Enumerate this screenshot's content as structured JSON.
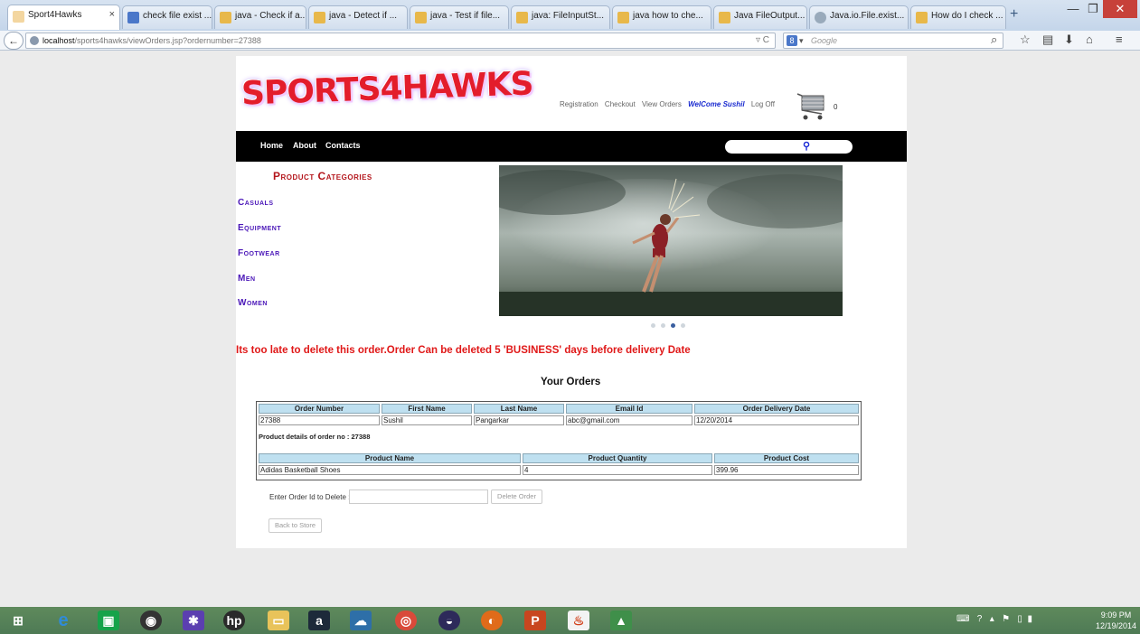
{
  "browser": {
    "tabs": [
      {
        "label": "Sport4Hawks",
        "active": true
      },
      {
        "label": "check file exist ..."
      },
      {
        "label": "java - Check if a..."
      },
      {
        "label": "java - Detect if ..."
      },
      {
        "label": "java - Test if file..."
      },
      {
        "label": "java: FileInputSt..."
      },
      {
        "label": "java how to che..."
      },
      {
        "label": "Java FileOutput..."
      },
      {
        "label": "Java.io.File.exist..."
      },
      {
        "label": "How do I check ..."
      }
    ],
    "tab_close": "×",
    "new_tab": "+",
    "url_host": "localhost",
    "url_path": "/sports4hawks/viewOrders.jsp?ordernumber=27388",
    "url_tools": "▿ C",
    "search_engine": "8",
    "search_placeholder": "Google",
    "window_buttons": {
      "min": "—",
      "max": "❐",
      "close": "✕"
    },
    "nav_icons": {
      "search": "⌕",
      "bookmark": "☆",
      "library": "▤",
      "download": "⬇",
      "home": "⌂",
      "menu": "≡"
    }
  },
  "site": {
    "logo": "SPORTS4HAWKS",
    "top_links": {
      "registration": "Registration",
      "checkout": "Checkout",
      "view_orders": "View Orders",
      "welcome": "WelCome Sushil",
      "logoff": "Log Off"
    },
    "cart_count": "0",
    "menu": {
      "home": "Home",
      "about": "About",
      "contacts": "Contacts"
    },
    "search_icon": "⚲",
    "categories_title": "Product Categories",
    "categories": [
      "Casuals",
      "Equipment",
      "Footwear",
      "Men",
      "Women"
    ],
    "late_message": "Its too late to delete this order.Order Can be deleted 5 'BUSINESS' days before delivery Date",
    "orders_title": "Your Orders",
    "orders_table": {
      "headers": [
        "Order Number",
        "First Name",
        "Last Name",
        "Email Id",
        "Order Delivery Date"
      ],
      "row": [
        "27388",
        "Sushil",
        "Pangarkar",
        "abc@gmail.com",
        "12/20/2014"
      ]
    },
    "product_details_label": "Product details of order no : 27388",
    "products_table": {
      "headers": [
        "Product Name",
        "Product Quantity",
        "Product Cost"
      ],
      "row": [
        "Adidas Basketball Shoes",
        "4",
        "399.96"
      ]
    },
    "delete_label": "Enter Order Id to Delete :",
    "delete_button": "Delete Order",
    "back_button": "Back to Store"
  },
  "taskbar": {
    "clock_time": "9:09 PM",
    "clock_date": "12/19/2014"
  },
  "colors": {
    "accent_red": "#e01818",
    "category_purple": "#4a16b8",
    "table_header": "#bfe0f0"
  }
}
